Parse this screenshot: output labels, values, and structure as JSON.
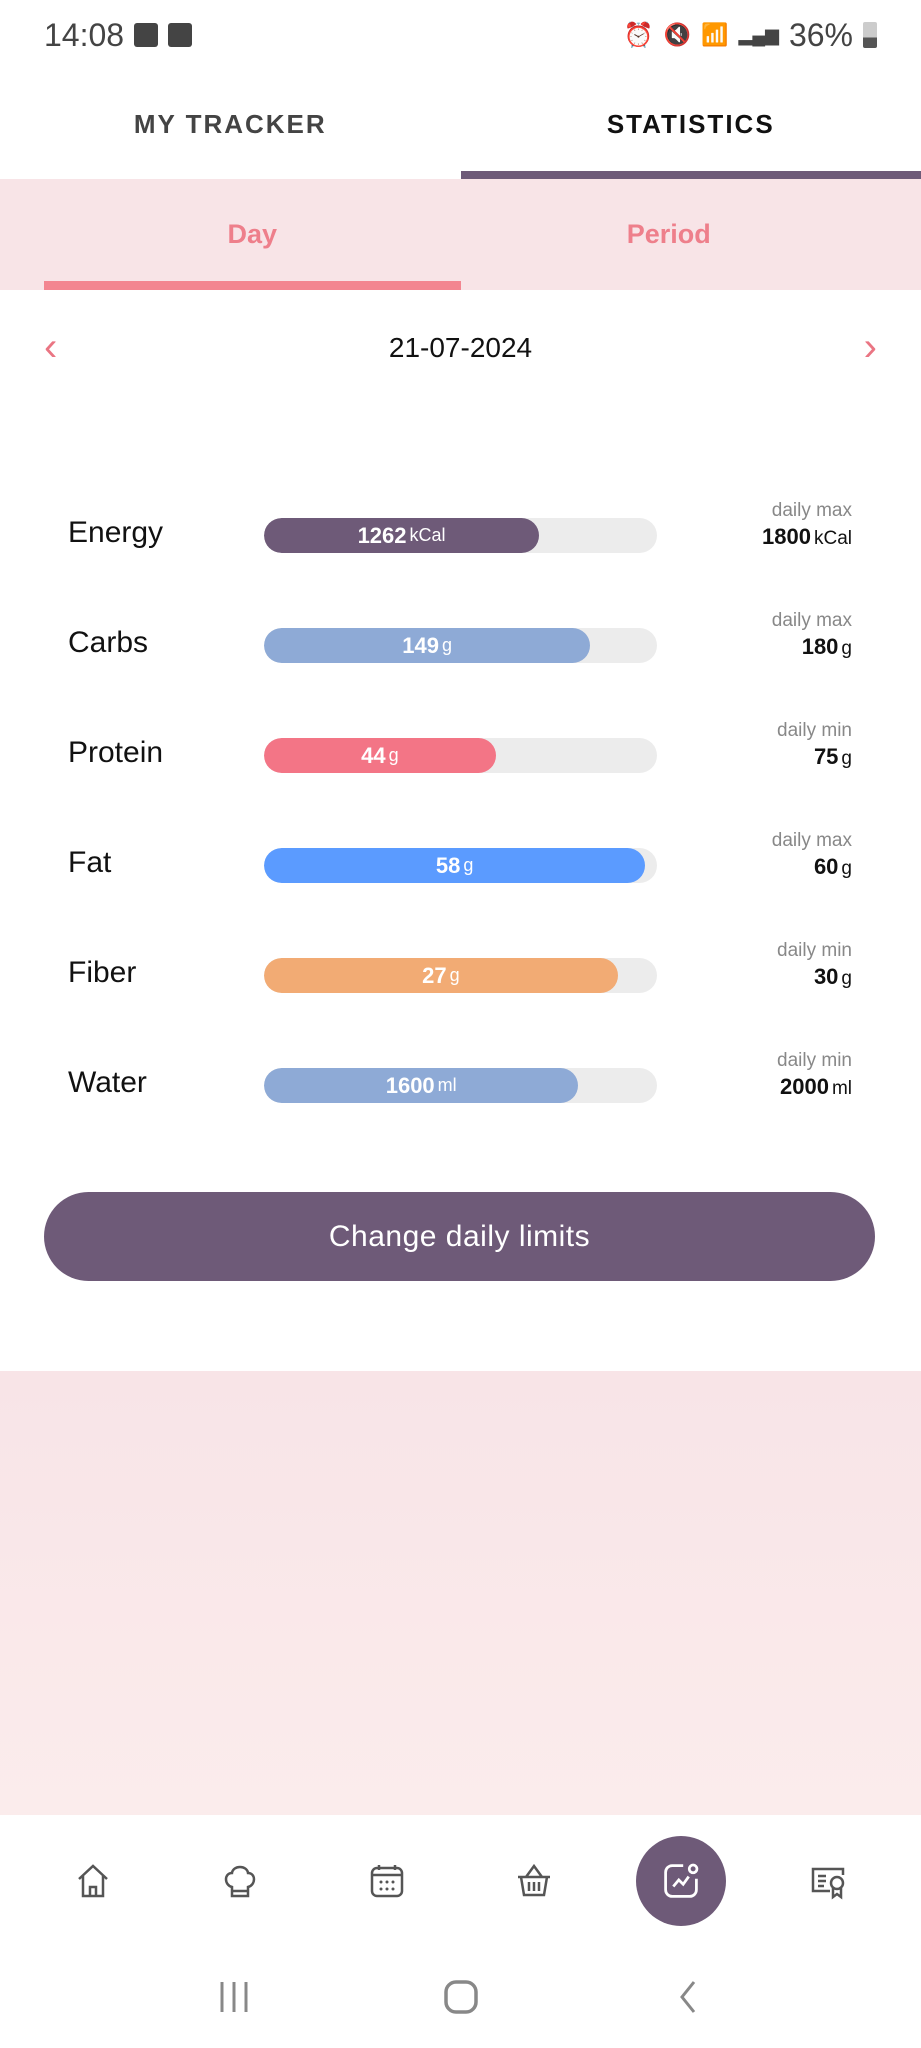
{
  "status_bar": {
    "time": "14:08",
    "battery": "36%",
    "icons": [
      "gallery-icon",
      "clock-app-icon",
      "alarm-icon",
      "mute-icon",
      "wifi-icon",
      "signal-icon",
      "volte-lte2-icon",
      "signal-icon",
      "battery-icon"
    ]
  },
  "top_tabs": [
    {
      "label": "MY TRACKER",
      "active": false
    },
    {
      "label": "STATISTICS",
      "active": true
    }
  ],
  "sub_tabs": [
    {
      "label": "Day",
      "active": true
    },
    {
      "label": "Period",
      "active": false
    }
  ],
  "date_nav": {
    "date": "21-07-2024",
    "prev_icon": "chevron-left-icon",
    "next_icon": "chevron-right-icon"
  },
  "nutrients": [
    {
      "name": "Energy",
      "value": "1262",
      "unit": "kCal",
      "limit_kind": "daily max",
      "limit": "1800",
      "limit_unit": "kCal",
      "progress": 0.7,
      "color": "#6e5a78"
    },
    {
      "name": "Carbs",
      "value": "149",
      "unit": "g",
      "limit_kind": "daily max",
      "limit": "180",
      "limit_unit": "g",
      "progress": 0.83,
      "color": "#8eaad6"
    },
    {
      "name": "Protein",
      "value": "44",
      "unit": "g",
      "limit_kind": "daily min",
      "limit": "75",
      "limit_unit": "g",
      "progress": 0.59,
      "color": "#f37586"
    },
    {
      "name": "Fat",
      "value": "58",
      "unit": "g",
      "limit_kind": "daily max",
      "limit": "60",
      "limit_unit": "g",
      "progress": 0.97,
      "color": "#5b9bff"
    },
    {
      "name": "Fiber",
      "value": "27",
      "unit": "g",
      "limit_kind": "daily min",
      "limit": "30",
      "limit_unit": "g",
      "progress": 0.9,
      "color": "#f2ab74"
    },
    {
      "name": "Water",
      "value": "1600",
      "unit": "ml",
      "limit_kind": "daily min",
      "limit": "2000",
      "limit_unit": "ml",
      "progress": 0.8,
      "color": "#8eaad6"
    }
  ],
  "change_limits_label": "Change daily limits",
  "bottom_nav": [
    {
      "icon": "home-icon"
    },
    {
      "icon": "chef-hat-icon"
    },
    {
      "icon": "calendar-icon"
    },
    {
      "icon": "basket-icon"
    },
    {
      "icon": "statistics-chart-icon",
      "active": true
    },
    {
      "icon": "certificate-icon"
    }
  ],
  "colors": {
    "accent": "#6e5a78",
    "pink": "#ee7f8b"
  }
}
